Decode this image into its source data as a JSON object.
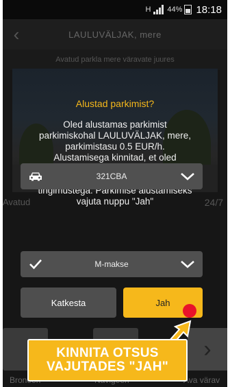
{
  "status_bar": {
    "network": "H",
    "battery_pct": "44%",
    "time": "18:18"
  },
  "header": {
    "title": "LAULUVÄLJAK, mere",
    "subtitle": "Avatud parkla mere väravate juures"
  },
  "background": {
    "left_label": "Avatud",
    "right_label": "24/7",
    "bottom_labels": [
      "Broneeri",
      "Navigeeri",
      "Ava värav"
    ]
  },
  "dialog": {
    "title": "Alustad parkimist?",
    "body": "Oled alustamas parkimist parkimiskohal LAULUVÄLJAK, mere, parkimistasu 0.5 EUR/h. Alustamisega kinnitad, et oled tutvunud üldtingimustega ning nõustud parkimislepingu tingimustega. Parkimise alustamiseks vajuta nuppu \"Jah\"",
    "vehicle": "321CBA",
    "payment": "M-makse",
    "cancel_label": "Katkesta",
    "confirm_label": "Jah"
  },
  "callout": {
    "line1": "KINNITA OTSUS",
    "line2": "VAJUTADES \"JAH\""
  },
  "colors": {
    "accent": "#f6b81b",
    "marker": "#e8132a"
  }
}
